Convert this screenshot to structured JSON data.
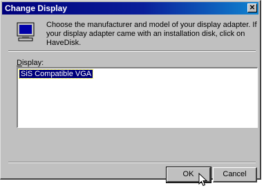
{
  "window": {
    "title": "Change Display",
    "close_glyph": "✕"
  },
  "message": {
    "text": "Choose the manufacturer and model of your display adapter.  If your display adapter came with an installation disk, click on HaveDisk.",
    "icon": "monitor-icon"
  },
  "display": {
    "label_prefix": "D",
    "label_rest": "isplay:",
    "selected_item": "SiS Compatible VGA"
  },
  "buttons": {
    "ok": "OK",
    "cancel": "Cancel"
  },
  "colors": {
    "title_gradient_start": "#00007b",
    "title_gradient_end": "#1084d0",
    "face": "#c0c0c0",
    "selection": "#00007b"
  }
}
